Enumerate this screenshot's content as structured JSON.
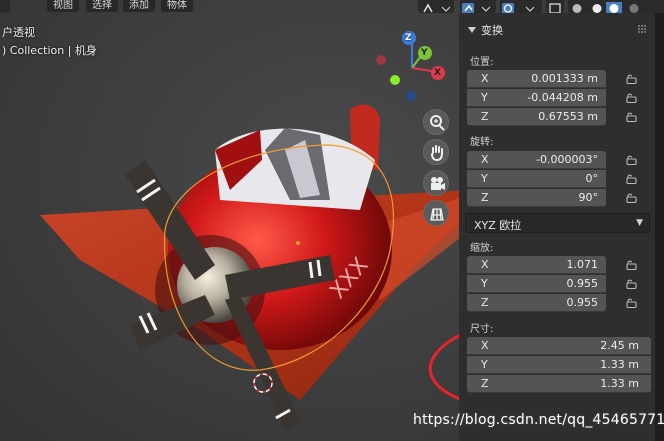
{
  "header": {
    "menu": [
      "视图",
      "选择",
      "添加",
      "物体"
    ]
  },
  "viewport": {
    "view_name": "户透视",
    "collection_path": ") Collection | 机身",
    "gizmo_axes": [
      "Z",
      "Y",
      "X"
    ]
  },
  "panel": {
    "title": "变换",
    "location": {
      "label": "位置:",
      "x": "0.001333 m",
      "y": "-0.044208 m",
      "z": "0.67553 m"
    },
    "rotation": {
      "label": "旋转:",
      "x": "-0.000003°",
      "y": "0°",
      "z": "90°",
      "mode": "XYZ 欧拉"
    },
    "scale": {
      "label": "缩放:",
      "x": "1.071",
      "y": "0.955",
      "z": "0.955"
    },
    "dimensions": {
      "label": "尺寸:",
      "x": "2.45 m",
      "y": "1.33 m",
      "z": "1.33 m"
    },
    "axis_letters": {
      "x": "X",
      "y": "Y",
      "z": "Z"
    }
  },
  "watermark": "https://blog.csdn.net/qq_45465771",
  "colors": {
    "accent": "#4a7fc1",
    "annotation_circle": "#e8232a",
    "selection_outline": "#f09a2c"
  }
}
